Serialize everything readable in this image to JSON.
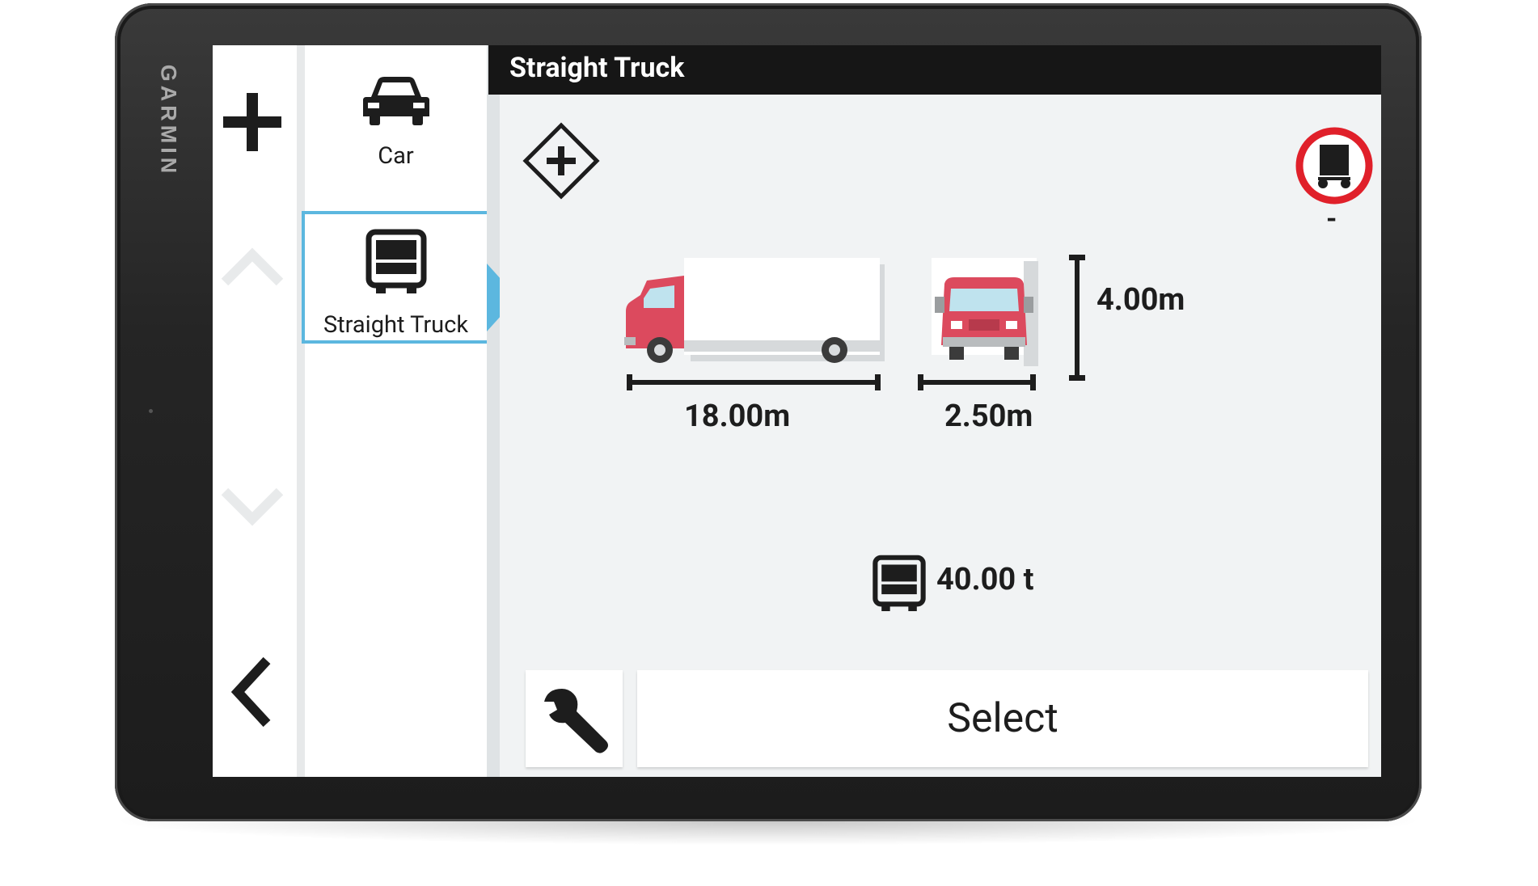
{
  "device": {
    "brand": "GARMIN"
  },
  "nav": {
    "icons": [
      "plus-icon",
      "chevron-up-icon",
      "chevron-down-icon",
      "back-arrow-icon"
    ]
  },
  "vehicle_list": {
    "items": [
      {
        "label": "Car",
        "icon": "car-icon",
        "selected": false
      },
      {
        "label": "Straight Truck",
        "icon": "truck-front-icon",
        "selected": true
      }
    ]
  },
  "header": {
    "title": "Straight Truck"
  },
  "profile": {
    "length": "18.00m",
    "width": "2.50m",
    "height": "4.00m",
    "weight": "40.00 t",
    "restriction_value": "-",
    "hazmat_icon": "hazmat-diamond-plus-icon",
    "restriction_icon": "no-trucks-sign-icon"
  },
  "actions": {
    "select_label": "Select",
    "tools_icon": "wrench-icon"
  },
  "colors": {
    "accent": "#5cb7df",
    "truck_red": "#dc4a5e",
    "sign_red": "#e0202a",
    "header_bg": "#161616",
    "content_bg": "#f1f3f4"
  }
}
